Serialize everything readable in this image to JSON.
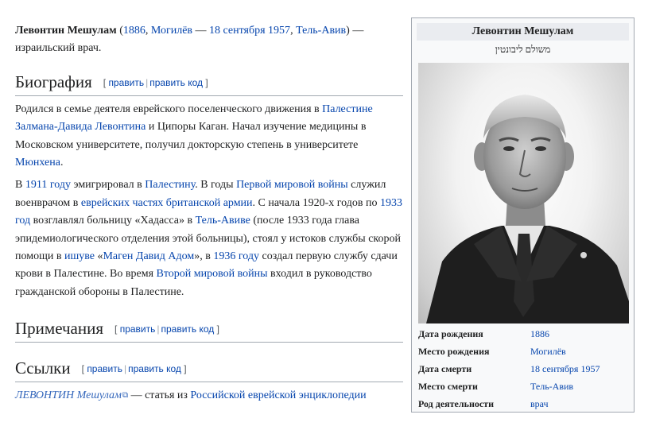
{
  "lead": {
    "name": "Левонтин Мешулам",
    "open_paren": " (",
    "birth_year": "1886",
    "comma1": ", ",
    "birth_place": "Могилёв",
    "dash": " — ",
    "death_date": "18 сентября 1957",
    "comma2": ", ",
    "death_place": "Тель-Авив",
    "close": ") — израильский врач."
  },
  "sections": {
    "biography": "Биография",
    "notes": "Примечания",
    "links": "Ссылки",
    "edit_open": "[",
    "edit": "править",
    "edit_code": "править код",
    "edit_close": "]"
  },
  "bio_p1": {
    "t1": "Родился в семье деятеля еврейского поселенческого движения в ",
    "l1": "Палестине",
    "t2": " ",
    "l2": "Залмана-Давида Левонтина",
    "t3": " и Ципоры Каган. Начал изучение медицины в Московском университете, получил докторскую степень в университете ",
    "l3": "Мюнхена",
    "t4": "."
  },
  "bio_p2": {
    "t1": "В ",
    "l1": "1911 году",
    "t2": " эмигрировал в ",
    "l2": "Палестину",
    "t3": ". В годы ",
    "l3": "Первой мировой войны",
    "t4": " служил военврачом в ",
    "l4": "еврейских частях британской армии",
    "t5": ". С начала 1920-х годов по ",
    "l5": "1933 год",
    "t6": " возглавлял больницу «Хадасса» в ",
    "l6": "Тель-Авиве",
    "t7": " (после 1933 года глава эпидемиологического отделения этой больницы), стоял у истоков службы скорой помощи в ",
    "l7": "ишуве",
    "t8": " «",
    "l8": "Маген Давид Адом",
    "t9": "», в ",
    "l9": "1936 году",
    "t10": " создал первую службу сдачи крови в Палестине. Во время ",
    "l10": "Второй мировой войны",
    "t11": " входил в руководство гражданской обороны в Палестине."
  },
  "links_p": {
    "ext": "ЛЕВОНТИН Мешулам",
    "ext_mark": "⧉",
    "t1": " — статья из ",
    "l1": "Российской еврейской энциклопедии"
  },
  "infobox": {
    "title": "Левонтин Мешулам",
    "subtitle": "משולם ליבונטין",
    "rows": [
      {
        "label": "Дата рождения",
        "value": "1886"
      },
      {
        "label": "Место рождения",
        "value": "Могилёв"
      },
      {
        "label": "Дата смерти",
        "value": "18 сентября 1957"
      },
      {
        "label": "Место смерти",
        "value": "Тель-Авив"
      },
      {
        "label": "Род деятельности",
        "value": "врач"
      }
    ]
  },
  "colors": {
    "link": "#0645ad",
    "text": "#202122",
    "border": "#a2a9b1",
    "infobox_bg": "#f8f9fa"
  }
}
